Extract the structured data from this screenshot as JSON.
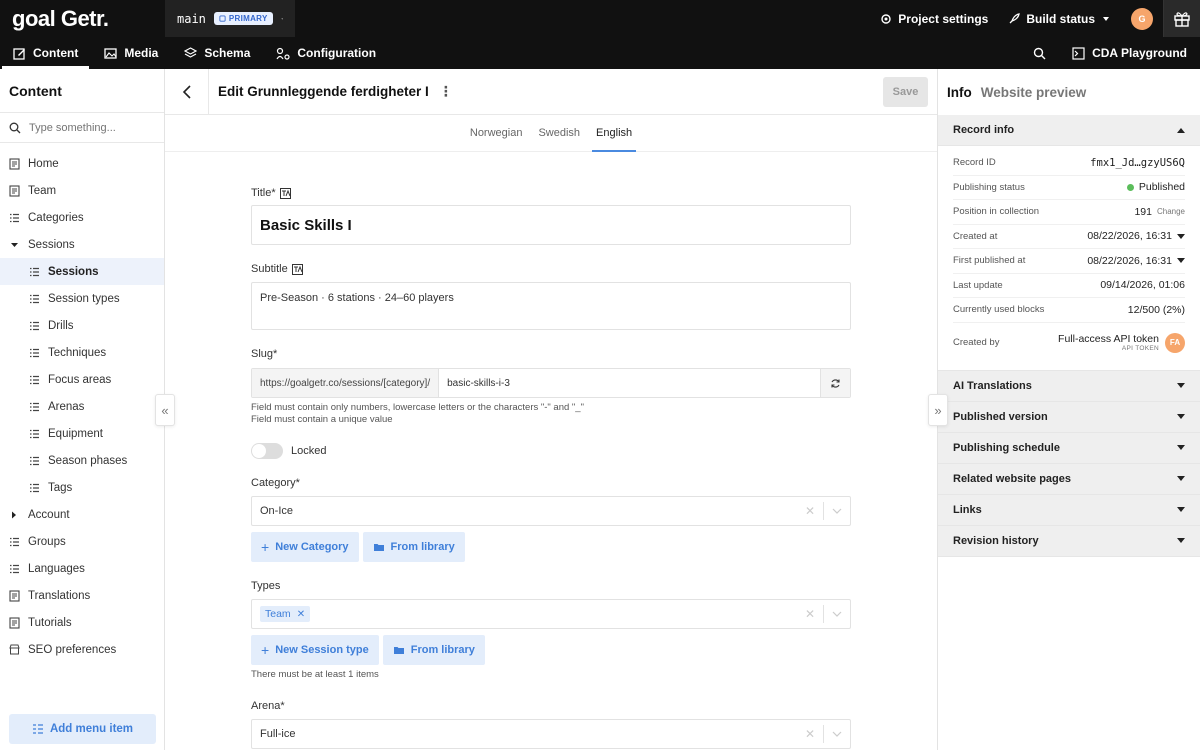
{
  "topbar": {
    "logo": "goal Getr.",
    "environment": "main",
    "environment_badge": "PRIMARY",
    "project_settings": "Project settings",
    "build_status": "Build status",
    "avatar_initial": "G"
  },
  "nav": {
    "tabs": [
      {
        "label": "Content",
        "icon": "pencil-icon",
        "active": true
      },
      {
        "label": "Media",
        "icon": "image-icon"
      },
      {
        "label": "Schema",
        "icon": "layers-icon"
      },
      {
        "label": "Configuration",
        "icon": "configuration-icon"
      }
    ],
    "cda_playground": "CDA Playground"
  },
  "sidebar": {
    "title": "Content",
    "search_placeholder": "Type something...",
    "items": [
      {
        "label": "Home",
        "icon": "document-icon"
      },
      {
        "label": "Team",
        "icon": "document-icon"
      },
      {
        "label": "Categories",
        "icon": "list-icon"
      },
      {
        "label": "Sessions",
        "icon": "caret-down-icon"
      },
      {
        "label": "Sessions",
        "icon": "list-icon",
        "active": true
      },
      {
        "label": "Session types",
        "icon": "list-icon"
      },
      {
        "label": "Drills",
        "icon": "list-icon"
      },
      {
        "label": "Techniques",
        "icon": "list-icon"
      },
      {
        "label": "Focus areas",
        "icon": "list-icon"
      },
      {
        "label": "Arenas",
        "icon": "list-icon"
      },
      {
        "label": "Equipment",
        "icon": "list-icon"
      },
      {
        "label": "Season phases",
        "icon": "list-icon"
      },
      {
        "label": "Tags",
        "icon": "list-icon"
      },
      {
        "label": "Account",
        "icon": "caret-right-icon"
      },
      {
        "label": "Groups",
        "icon": "list-icon"
      },
      {
        "label": "Languages",
        "icon": "list-icon"
      },
      {
        "label": "Translations",
        "icon": "document-icon"
      },
      {
        "label": "Tutorials",
        "icon": "document-icon"
      },
      {
        "label": "SEO preferences",
        "icon": "store-icon"
      }
    ],
    "add_menu_item": "Add menu item"
  },
  "main": {
    "edit_title": "Edit Grunnleggende ferdigheter I",
    "save_label": "Save",
    "locales": [
      "Norwegian",
      "Swedish",
      "English"
    ],
    "active_locale": "English",
    "form": {
      "title_label": "Title*",
      "title_value": "Basic Skills I",
      "subtitle_label": "Subtitle",
      "subtitle_value": "Pre-Season · 6 stations · 24–60 players",
      "slug_label": "Slug*",
      "slug_prefix": "https://goalgetr.co/sessions/[category]/",
      "slug_value": "basic-skills-i-3",
      "slug_hint_1": "Field must contain only numbers, lowercase letters or the characters \"-\" and \"_\"",
      "slug_hint_2": "Field must contain a unique value",
      "locked_label": "Locked",
      "category_label": "Category*",
      "category_value": "On-Ice",
      "new_category": "New Category",
      "from_library": "From library",
      "types_label": "Types",
      "types_chip": "Team",
      "new_session_type": "New Session type",
      "types_hint": "There must be at least 1 items",
      "arena_label": "Arena*",
      "arena_value": "Full-ice"
    }
  },
  "right_panel": {
    "tabs": [
      "Info",
      "Website preview"
    ],
    "record_info_title": "Record info",
    "rows": [
      {
        "label": "Record ID",
        "value": "fmx1_Jd…gzyUS6Q"
      },
      {
        "label": "Publishing status",
        "value": "Published"
      },
      {
        "label": "Position in collection",
        "value": "191",
        "extra": "Change"
      },
      {
        "label": "Created at",
        "value": "08/22/2026, 16:31"
      },
      {
        "label": "First published at",
        "value": "08/22/2026, 16:31"
      },
      {
        "label": "Last update",
        "value": "09/14/2026, 01:06"
      },
      {
        "label": "Currently used blocks",
        "value": "12/500 (2%)"
      }
    ],
    "created_by_label": "Created by",
    "created_by_name": "Full-access API token",
    "created_by_sub": "API TOKEN",
    "created_by_initials": "FA",
    "sections": [
      "AI Translations",
      "Published version",
      "Publishing schedule",
      "Related website pages",
      "Links",
      "Revision history"
    ]
  },
  "colors": {
    "accent": "#3f7fd9",
    "accent_light": "#e3edfb",
    "published": "#5bbd5b",
    "avatar": "#f6a56b"
  }
}
